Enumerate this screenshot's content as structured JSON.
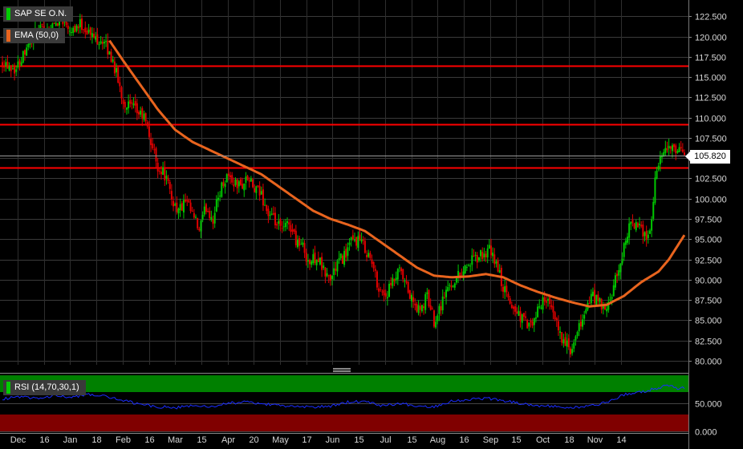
{
  "legend": {
    "symbol": "SAP SE O.N.",
    "ema": "EMA (50,0)",
    "rsi": "RSI (14,70,30,1)",
    "symbol_color": "#00cc00",
    "ema_color": "#e8641e"
  },
  "last_price_label": "105.820",
  "colors": {
    "up": "#00c800",
    "down": "#e00000",
    "ema": "#e8641e",
    "hline": "#ff0000",
    "rsi": "#1a2cff",
    "overbought_zone": "#008000",
    "oversold_zone": "#800000",
    "mid_zone": "#cfcfcf"
  },
  "chart_data": [
    {
      "type": "candlestick",
      "title": "SAP SE O.N.",
      "ylim": [
        79.5,
        124.5
      ],
      "y_tick_labels": [
        "80.000",
        "82.500",
        "85.000",
        "87.500",
        "90.000",
        "92.500",
        "95.000",
        "97.500",
        "100.000",
        "102.500",
        "105.000",
        "107.500",
        "110.000",
        "112.500",
        "115.000",
        "117.500",
        "120.000",
        "122.500"
      ],
      "x_tick_labels": [
        "Dec",
        "16",
        "Jan",
        "18",
        "Feb",
        "16",
        "Mar",
        "15",
        "Apr",
        "20",
        "May",
        "17",
        "Jun",
        "15",
        "Jul",
        "15",
        "Aug",
        "16",
        "Sep",
        "15",
        "Oct",
        "18",
        "Nov",
        "14"
      ],
      "horizontal_levels": [
        116.4,
        109.2,
        103.8
      ],
      "last_price": 105.82,
      "series": [
        {
          "name": "SAP SE O.N.",
          "kind": "ohlc"
        },
        {
          "name": "EMA (50,0)",
          "kind": "line"
        }
      ],
      "close_keyframes": [
        [
          0,
          117
        ],
        [
          8,
          116
        ],
        [
          14,
          119
        ],
        [
          20,
          120.5
        ],
        [
          28,
          121
        ],
        [
          34,
          122.5
        ],
        [
          40,
          121
        ],
        [
          46,
          121.5
        ],
        [
          52,
          120
        ],
        [
          58,
          119.5
        ],
        [
          64,
          117
        ],
        [
          70,
          112
        ],
        [
          76,
          111
        ],
        [
          82,
          110
        ],
        [
          86,
          107
        ],
        [
          90,
          104
        ],
        [
          94,
          103
        ],
        [
          98,
          100
        ],
        [
          102,
          98.5
        ],
        [
          106,
          99.5
        ],
        [
          110,
          98
        ],
        [
          114,
          96
        ],
        [
          118,
          99
        ],
        [
          122,
          97.5
        ],
        [
          126,
          101
        ],
        [
          130,
          103
        ],
        [
          134,
          102
        ],
        [
          138,
          101.5
        ],
        [
          142,
          102.5
        ],
        [
          146,
          101
        ],
        [
          150,
          100.5
        ],
        [
          154,
          98
        ],
        [
          158,
          97
        ],
        [
          162,
          96
        ],
        [
          166,
          97
        ],
        [
          170,
          95
        ],
        [
          174,
          94
        ],
        [
          178,
          92
        ],
        [
          182,
          93
        ],
        [
          186,
          91
        ],
        [
          190,
          90
        ],
        [
          194,
          92
        ],
        [
          198,
          93
        ],
        [
          202,
          94.5
        ],
        [
          206,
          95
        ],
        [
          210,
          94
        ],
        [
          214,
          92
        ],
        [
          218,
          89
        ],
        [
          222,
          88
        ],
        [
          226,
          89.5
        ],
        [
          230,
          91
        ],
        [
          234,
          89
        ],
        [
          238,
          87
        ],
        [
          242,
          86
        ],
        [
          246,
          88
        ],
        [
          250,
          85
        ],
        [
          254,
          87
        ],
        [
          258,
          89
        ],
        [
          262,
          90
        ],
        [
          266,
          91
        ],
        [
          270,
          92
        ],
        [
          274,
          92.5
        ],
        [
          278,
          93
        ],
        [
          282,
          93.5
        ],
        [
          286,
          92
        ],
        [
          290,
          89
        ],
        [
          294,
          87
        ],
        [
          298,
          86
        ],
        [
          302,
          85
        ],
        [
          306,
          84
        ],
        [
          310,
          86
        ],
        [
          314,
          88
        ],
        [
          318,
          86
        ],
        [
          322,
          84
        ],
        [
          326,
          82
        ],
        [
          330,
          81
        ],
        [
          334,
          84
        ],
        [
          338,
          86.5
        ],
        [
          342,
          88
        ],
        [
          346,
          87
        ],
        [
          350,
          86
        ],
        [
          354,
          89
        ],
        [
          358,
          92
        ],
        [
          362,
          96
        ],
        [
          366,
          97
        ],
        [
          370,
          96
        ],
        [
          374,
          95.5
        ],
        [
          376,
          97
        ],
        [
          378,
          103
        ],
        [
          382,
          105
        ],
        [
          386,
          106.5
        ],
        [
          390,
          105.5
        ],
        [
          394,
          105.8
        ]
      ],
      "ema_keyframes": [
        [
          62,
          119.5
        ],
        [
          70,
          117
        ],
        [
          80,
          114
        ],
        [
          90,
          111
        ],
        [
          100,
          108.5
        ],
        [
          110,
          107
        ],
        [
          120,
          106
        ],
        [
          130,
          105
        ],
        [
          140,
          104
        ],
        [
          150,
          103
        ],
        [
          160,
          101.5
        ],
        [
          170,
          100
        ],
        [
          180,
          98.5
        ],
        [
          190,
          97.5
        ],
        [
          200,
          96.8
        ],
        [
          210,
          96
        ],
        [
          220,
          94.5
        ],
        [
          230,
          93
        ],
        [
          240,
          91.5
        ],
        [
          250,
          90.5
        ],
        [
          260,
          90.3
        ],
        [
          270,
          90.4
        ],
        [
          280,
          90.7
        ],
        [
          290,
          90.3
        ],
        [
          300,
          89.3
        ],
        [
          310,
          88.5
        ],
        [
          320,
          87.8
        ],
        [
          330,
          87.2
        ],
        [
          340,
          86.7
        ],
        [
          350,
          86.9
        ],
        [
          360,
          88
        ],
        [
          370,
          89.7
        ],
        [
          380,
          91
        ],
        [
          386,
          92.5
        ],
        [
          392,
          94.5
        ],
        [
          395,
          95.5
        ]
      ]
    },
    {
      "type": "line",
      "title": "RSI (14,70,30,1)",
      "ylim": [
        -3,
        103
      ],
      "y_tick_labels": [
        "50.000",
        "0.000"
      ],
      "zones": {
        "overbought": 70,
        "oversold": 30
      },
      "series": [
        {
          "name": "RSI (14,70,30,1)",
          "keyframes": [
            [
              0,
              58
            ],
            [
              10,
              62
            ],
            [
              20,
              58
            ],
            [
              30,
              64
            ],
            [
              40,
              60
            ],
            [
              50,
              66
            ],
            [
              60,
              62
            ],
            [
              70,
              55
            ],
            [
              80,
              48
            ],
            [
              90,
              44
            ],
            [
              100,
              42
            ],
            [
              110,
              46
            ],
            [
              120,
              43
            ],
            [
              130,
              50
            ],
            [
              140,
              52
            ],
            [
              150,
              49
            ],
            [
              160,
              46
            ],
            [
              170,
              44
            ],
            [
              180,
              43
            ],
            [
              190,
              45
            ],
            [
              200,
              52
            ],
            [
              210,
              54
            ],
            [
              220,
              46
            ],
            [
              230,
              50
            ],
            [
              240,
              45
            ],
            [
              250,
              44
            ],
            [
              260,
              54
            ],
            [
              270,
              57
            ],
            [
              280,
              59
            ],
            [
              290,
              55
            ],
            [
              300,
              50
            ],
            [
              310,
              46
            ],
            [
              320,
              44
            ],
            [
              330,
              42
            ],
            [
              340,
              45
            ],
            [
              350,
              52
            ],
            [
              360,
              65
            ],
            [
              370,
              70
            ],
            [
              380,
              78
            ],
            [
              386,
              82
            ],
            [
              392,
              76
            ],
            [
              396,
              78
            ]
          ]
        }
      ]
    }
  ]
}
